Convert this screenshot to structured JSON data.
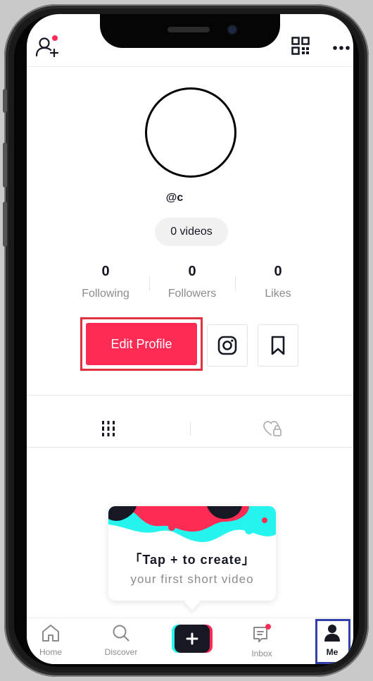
{
  "profile": {
    "username": "@c",
    "videos_label": "0 videos"
  },
  "stats": [
    {
      "value": "0",
      "label": "Following"
    },
    {
      "value": "0",
      "label": "Followers"
    },
    {
      "value": "0",
      "label": "Likes"
    }
  ],
  "actions": {
    "edit_profile_label": "Edit Profile"
  },
  "create_card": {
    "line1": "「Tap + to create」",
    "line2": "your first short video"
  },
  "nav": {
    "home": "Home",
    "discover": "Discover",
    "inbox": "Inbox",
    "me": "Me"
  },
  "icons": {
    "add_friend": "add-user-icon",
    "qr": "qr-code-icon",
    "more": "more-icon",
    "instagram": "instagram-icon",
    "bookmark": "bookmark-icon",
    "grid": "video-grid-icon",
    "liked": "liked-lock-icon"
  },
  "colors": {
    "accent": "#fe2c55",
    "cyan": "#25f4ee",
    "text": "#161823",
    "muted": "#8a8b91",
    "highlight_edit": "#e0313f",
    "highlight_me": "#3340a8"
  }
}
